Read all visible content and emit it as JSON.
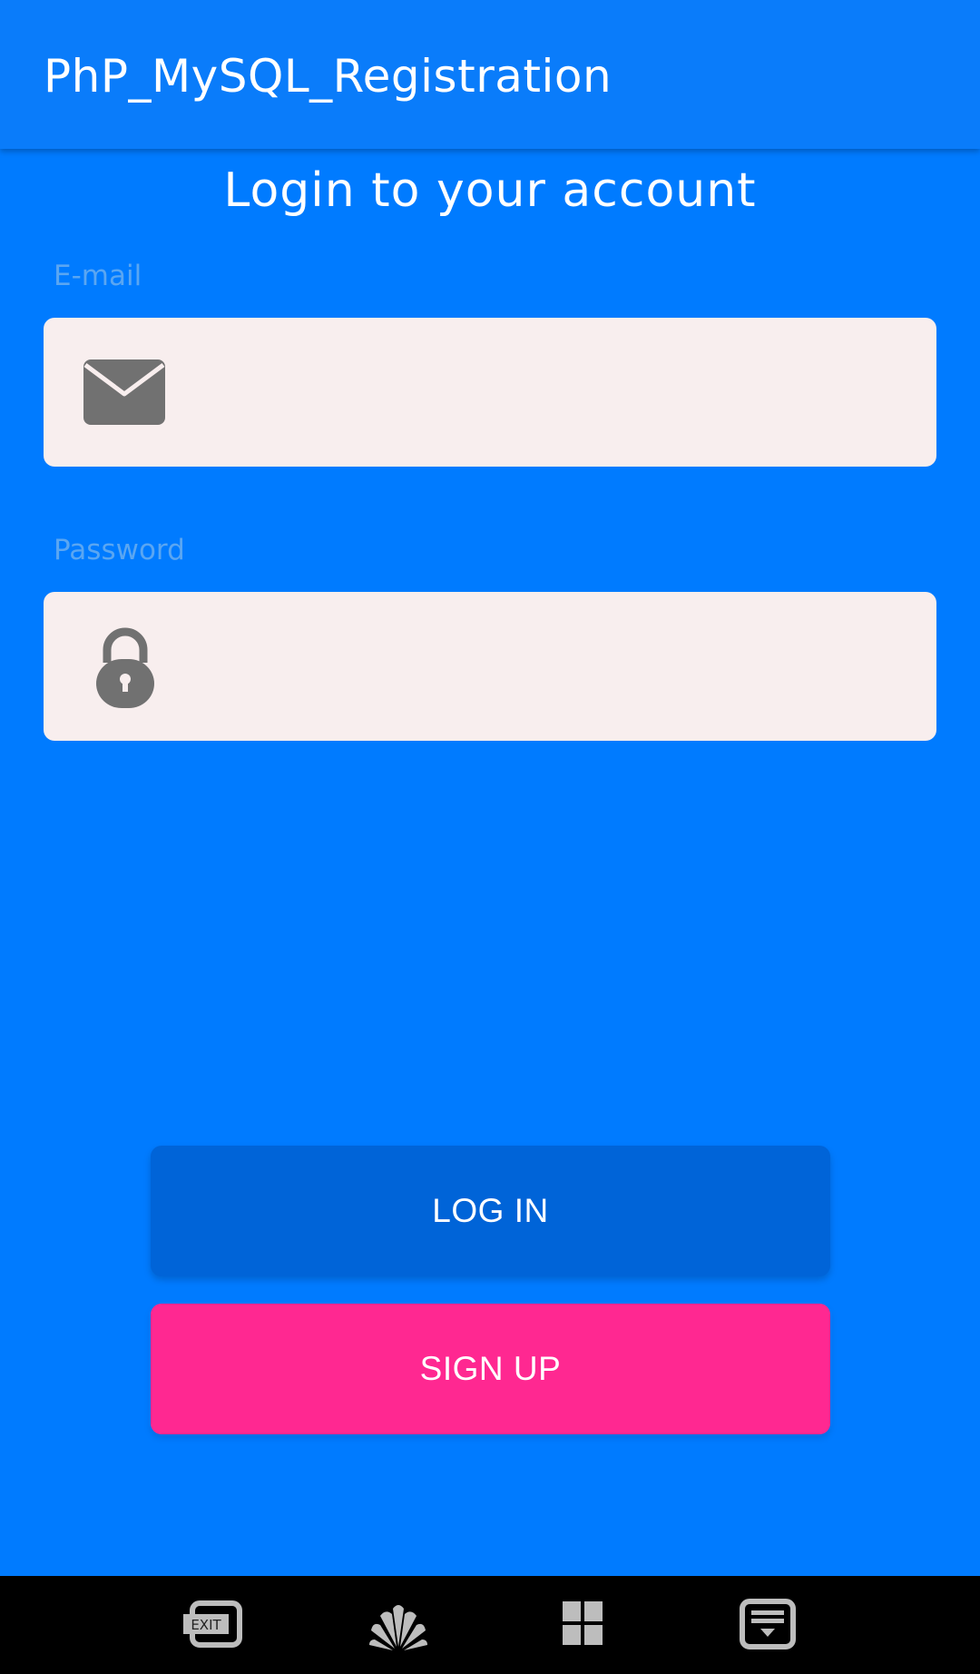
{
  "app_bar": {
    "title": "PhP_MySQL_Registration"
  },
  "screen": {
    "title": "Login to your account"
  },
  "email": {
    "label": "E-mail",
    "value": "",
    "icon": "envelope-icon"
  },
  "password": {
    "label": "Password",
    "value": "",
    "icon": "lock-icon"
  },
  "buttons": {
    "login_label": "LOG IN",
    "signup_label": "SIGN UP"
  },
  "nav_bar": {
    "exit_label": "EXIT",
    "icons": [
      "exit-icon",
      "huawei-logo-icon",
      "grid-icon",
      "keyboard-hide-icon"
    ]
  },
  "colors": {
    "background": "#007BFF",
    "app_bar": "#0A7CFA",
    "input_background": "#F8EEEE",
    "label_text": "#5AA6F2",
    "login_button": "#0064D8",
    "signup_button": "#FF2891",
    "icon_gray": "#717171"
  }
}
